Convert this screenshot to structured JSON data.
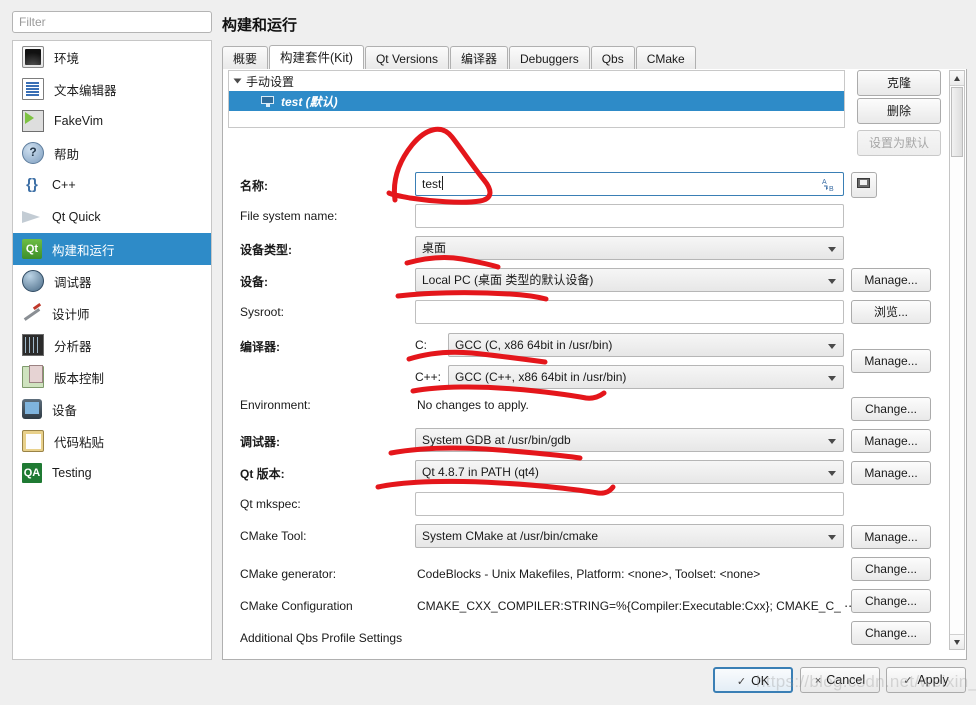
{
  "window": {
    "title": "构建和运行",
    "watermark": "https://blog.csdn.net/weixin_..."
  },
  "sidebar": {
    "filter_placeholder": "Filter",
    "filter_value": "",
    "items": [
      {
        "label": "环境",
        "icon": "monitor-icon",
        "selected": false
      },
      {
        "label": "文本编辑器",
        "icon": "text-editor-icon",
        "selected": false
      },
      {
        "label": "FakeVim",
        "icon": "fakevim-icon",
        "selected": false
      },
      {
        "label": "帮助",
        "icon": "help-icon",
        "selected": false
      },
      {
        "label": "C++",
        "icon": "braces-icon",
        "selected": false
      },
      {
        "label": "Qt Quick",
        "icon": "qtquick-icon",
        "selected": false
      },
      {
        "label": "构建和运行",
        "icon": "build-run-icon",
        "selected": true
      },
      {
        "label": "调试器",
        "icon": "debugger-bug-icon",
        "selected": false
      },
      {
        "label": "设计师",
        "icon": "designer-pen-icon",
        "selected": false
      },
      {
        "label": "分析器",
        "icon": "analyzer-icon",
        "selected": false
      },
      {
        "label": "版本控制",
        "icon": "version-control-icon",
        "selected": false
      },
      {
        "label": "设备",
        "icon": "device-icon",
        "selected": false
      },
      {
        "label": "代码粘贴",
        "icon": "code-paste-icon",
        "selected": false
      },
      {
        "label": "Testing",
        "icon": "qa-icon",
        "selected": false
      }
    ]
  },
  "tabs": [
    {
      "label": "概要",
      "active": false
    },
    {
      "label": "构建套件(Kit)",
      "active": true
    },
    {
      "label": "Qt Versions",
      "active": false
    },
    {
      "label": "编译器",
      "active": false
    },
    {
      "label": "Debuggers",
      "active": false
    },
    {
      "label": "Qbs",
      "active": false
    },
    {
      "label": "CMake",
      "active": false
    }
  ],
  "kit_tree": {
    "root_label": "手动设置",
    "child_label": "test (默认)",
    "child_selected": true
  },
  "kit_buttons": [
    {
      "label": "克隆",
      "enabled": true
    },
    {
      "label": "删除",
      "enabled": true
    },
    {
      "label": "设置为默认",
      "enabled": false
    }
  ],
  "form": {
    "rows": [
      {
        "label": "名称:",
        "type": "lineedit",
        "value": "test",
        "bold": true,
        "button": null
      },
      {
        "label": "File system name:",
        "type": "lineedit",
        "value": "",
        "bold": false,
        "button": null
      },
      {
        "label": "设备类型:",
        "type": "combo",
        "value": "桌面",
        "bold": true,
        "button": null
      },
      {
        "label": "设备:",
        "type": "combo",
        "value": "Local PC (桌面 类型的默认设备)",
        "bold": true,
        "button": "Manage..."
      },
      {
        "label": "Sysroot:",
        "type": "lineedit",
        "value": "",
        "bold": false,
        "button": "浏览..."
      },
      {
        "label": "编译器:",
        "type": "combo",
        "value": "GCC (C, x86 64bit in /usr/bin)",
        "prefix": "C:",
        "bold": true,
        "button": null
      },
      {
        "label": "",
        "type": "combo",
        "value": "GCC (C++, x86 64bit in /usr/bin)",
        "prefix": "C++:",
        "bold": false,
        "button": "Manage..."
      },
      {
        "label": "Environment:",
        "type": "text",
        "value": "No changes to apply.",
        "bold": false,
        "button": "Change..."
      },
      {
        "label": "调试器:",
        "type": "combo",
        "value": "System GDB at /usr/bin/gdb",
        "bold": true,
        "button": "Manage..."
      },
      {
        "label": "Qt 版本:",
        "type": "combo",
        "value": "Qt 4.8.7 in PATH (qt4)",
        "bold": true,
        "button": "Manage..."
      },
      {
        "label": "Qt mkspec:",
        "type": "lineedit",
        "value": "",
        "bold": false,
        "button": null
      },
      {
        "label": "CMake Tool:",
        "type": "combo",
        "value": "System CMake at /usr/bin/cmake",
        "bold": false,
        "button": "Manage..."
      },
      {
        "label": "CMake generator:",
        "type": "text",
        "value": "CodeBlocks - Unix Makefiles, Platform: <none>, Toolset: <none>",
        "bold": false,
        "button": "Change..."
      },
      {
        "label": "CMake Configuration",
        "type": "text",
        "value": "CMAKE_CXX_COMPILER:STRING=%{Compiler:Executable:Cxx}; CMAKE_C_ ⋯",
        "bold": false,
        "button": "Change..."
      },
      {
        "label": "Additional Qbs Profile Settings",
        "type": "none",
        "value": "",
        "bold": false,
        "button": "Change..."
      }
    ],
    "name_field_icon": "variable-substitution-icon",
    "device_type_button_icon": "monitor-icon"
  },
  "dialog_buttons": [
    {
      "label": "OK",
      "mark": "✓",
      "default": true
    },
    {
      "label": "Cancel",
      "mark": "×",
      "default": false
    },
    {
      "label": "Apply",
      "mark": "✓",
      "default": false
    }
  ],
  "colors": {
    "selection_blue": "#2e8bc8",
    "annotation_red": "#e4161b",
    "window_bg": "#efefef"
  }
}
